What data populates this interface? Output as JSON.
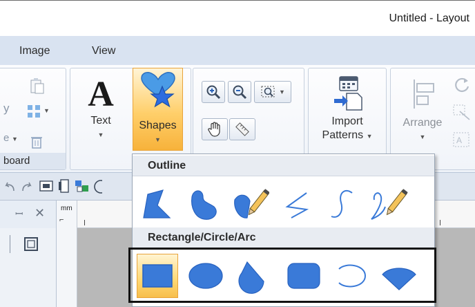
{
  "window": {
    "title": "Untitled - Layout"
  },
  "menu": {
    "items": [
      "Image",
      "View"
    ]
  },
  "ribbon": {
    "clipboard_group_label": "board",
    "clipboard_partial_letters": [
      "y",
      "e"
    ],
    "text_label": "Text",
    "shapes_label": "Shapes",
    "import_label_1": "Import",
    "import_label_2": "Patterns",
    "arrange_label": "Arrange"
  },
  "ruler": {
    "unit": "mm"
  },
  "dropdown": {
    "outline_header": "Outline",
    "rect_header": "Rectangle/Circle/Arc",
    "outline_shapes": [
      "polygon-outline",
      "bean-outline",
      "freehand-closed",
      "zigzag-line",
      "s-curve",
      "freehand-line"
    ],
    "rect_shapes": [
      "rectangle",
      "ellipse",
      "pie-sector",
      "rounded-rectangle",
      "arc",
      "chord"
    ],
    "selected_rect_shape": "rectangle"
  },
  "colors": {
    "shape_blue": "#3a7ad8",
    "ribbon_bg": "#eef2f8",
    "menubar_bg": "#d9e3f1",
    "selected_orange": "#f7b23b"
  }
}
